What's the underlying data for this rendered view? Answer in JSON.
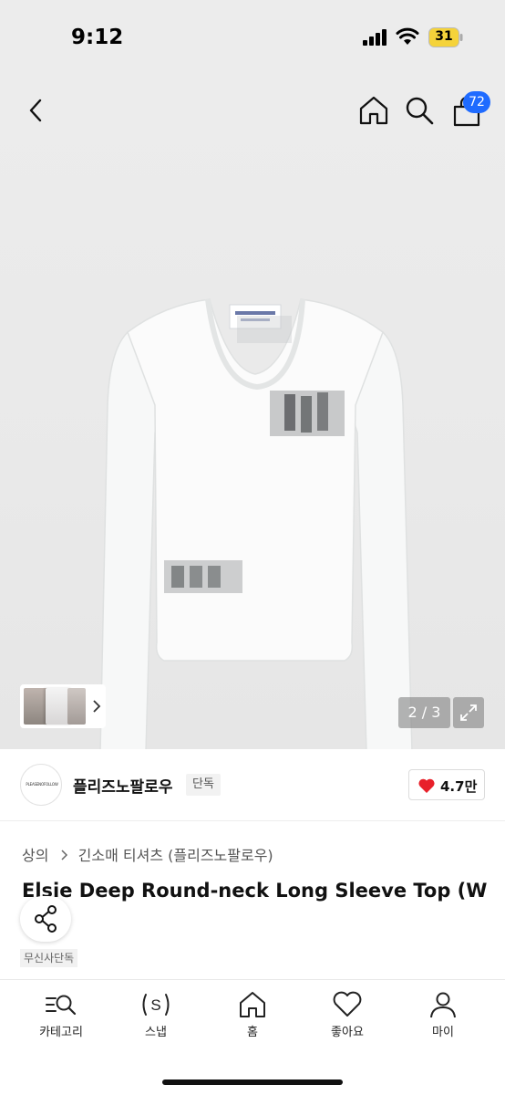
{
  "status_bar": {
    "time": "9:12",
    "battery": "31",
    "icons": [
      "signal-icon",
      "wifi-icon",
      "battery-icon"
    ]
  },
  "nav": {
    "icons": [
      "back-icon",
      "home-icon",
      "search-icon",
      "cart-icon"
    ],
    "cart_count": "72",
    "badge_color": "#1f6bff"
  },
  "gallery": {
    "page_indicator": "2 / 3",
    "icons": [
      "expand-icon",
      "chevron-right-icon"
    ]
  },
  "brand": {
    "logo_text": "PLEASENOFOLLOW",
    "name": "플리즈노팔로우",
    "tag": "단독",
    "likes": "4.7만",
    "heart_color": "#e8202a"
  },
  "product": {
    "breadcrumb": [
      "상의",
      "긴소매 티셔츠 (플리즈노팔로우)"
    ],
    "title": "Elsie Deep Round-neck Long Sleeve Top (W",
    "exclusive_badge": "무신사단독"
  },
  "tab_bar": {
    "tabs": [
      {
        "label": "카테고리",
        "icon": "category-search-icon"
      },
      {
        "label": "스냅",
        "icon": "snap-icon"
      },
      {
        "label": "홈",
        "icon": "home-icon"
      },
      {
        "label": "좋아요",
        "icon": "heart-icon"
      },
      {
        "label": "마이",
        "icon": "person-icon"
      }
    ]
  }
}
